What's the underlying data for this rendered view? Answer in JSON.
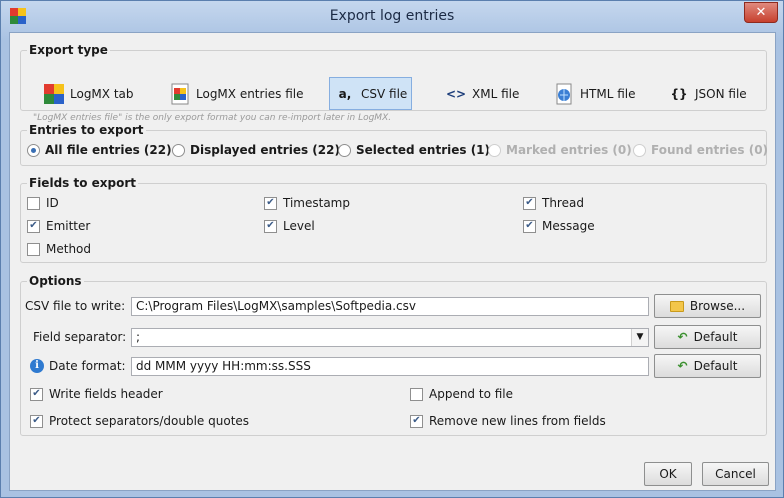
{
  "window": {
    "title": "Export log entries",
    "close_glyph": "✕"
  },
  "export_type": {
    "legend": "Export type",
    "options": [
      {
        "label": "LogMX tab",
        "icon": "logmx-tab-icon",
        "selected": false
      },
      {
        "label": "LogMX entries file",
        "icon": "logmx-file-icon",
        "selected": false
      },
      {
        "label": "CSV file",
        "icon": "csv-icon",
        "icon_text": "a,",
        "selected": true
      },
      {
        "label": "XML file",
        "icon": "xml-icon",
        "icon_text": "<>",
        "selected": false
      },
      {
        "label": "HTML file",
        "icon": "html-icon",
        "selected": false
      },
      {
        "label": "JSON file",
        "icon": "json-icon",
        "icon_text": "{}",
        "selected": false
      }
    ],
    "hint": "\"LogMX entries file\" is the only export format you can re-import later in LogMX."
  },
  "entries_to_export": {
    "legend": "Entries to export",
    "options": [
      {
        "label": "All file entries (22)",
        "checked": true,
        "enabled": true
      },
      {
        "label": "Displayed entries (22)",
        "checked": false,
        "enabled": true
      },
      {
        "label": "Selected entries (1)",
        "checked": false,
        "enabled": true
      },
      {
        "label": "Marked entries (0)",
        "checked": false,
        "enabled": false
      },
      {
        "label": "Found entries (0)",
        "checked": false,
        "enabled": false
      }
    ]
  },
  "fields_to_export": {
    "legend": "Fields to export",
    "fields": [
      {
        "label": "ID",
        "checked": false
      },
      {
        "label": "Timestamp",
        "checked": true
      },
      {
        "label": "Thread",
        "checked": true
      },
      {
        "label": "Emitter",
        "checked": true
      },
      {
        "label": "Level",
        "checked": true
      },
      {
        "label": "Message",
        "checked": true
      },
      {
        "label": "Method",
        "checked": false
      }
    ]
  },
  "options": {
    "legend": "Options",
    "csv_file_label": "CSV file to write:",
    "csv_file_value": "C:\\Program Files\\LogMX\\samples\\Softpedia.csv",
    "browse_label": "Browse...",
    "field_separator_label": "Field separator:",
    "field_separator_value": ";",
    "date_format_label": "Date format:",
    "date_format_value": "dd MMM yyyy HH:mm:ss.SSS",
    "default_label": "Default",
    "info_glyph": "i",
    "checkboxes": [
      {
        "label": "Write fields header",
        "checked": true
      },
      {
        "label": "Append to file",
        "checked": false
      },
      {
        "label": "Protect separators/double quotes",
        "checked": true
      },
      {
        "label": "Remove new lines from fields",
        "checked": true
      }
    ]
  },
  "footer": {
    "ok_label": "OK",
    "cancel_label": "Cancel"
  },
  "check_glyph": "✔",
  "arrow_glyph": "▼"
}
